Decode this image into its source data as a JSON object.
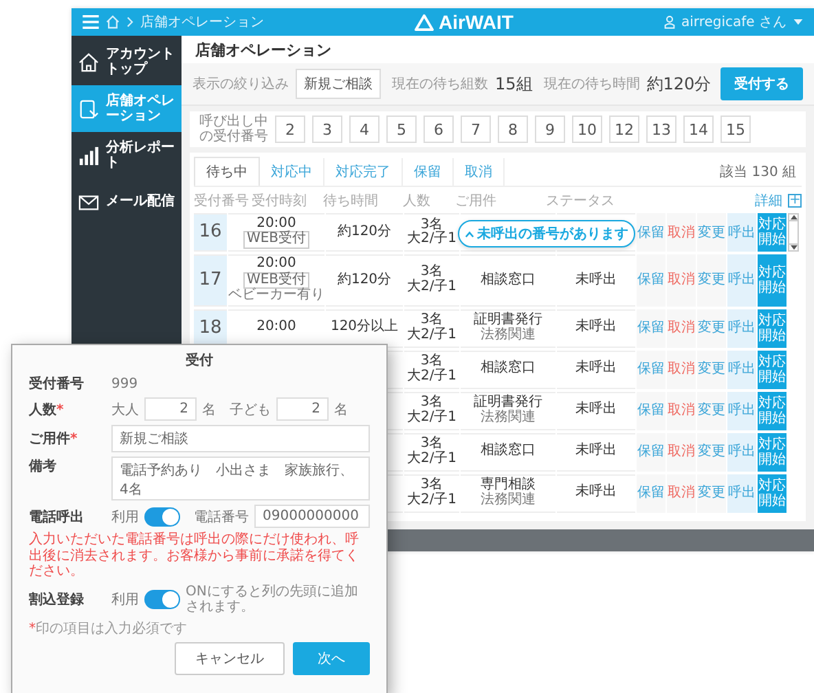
{
  "header": {
    "breadcrumb": "店舗オペレーション",
    "logo": "AirWAIT",
    "user": "airregicafe さん"
  },
  "sidebar": {
    "items": [
      {
        "label": "アカウントトップ",
        "selected": false
      },
      {
        "label": "店舗オペレーション",
        "selected": true
      },
      {
        "label": "分析レポート",
        "selected": false
      },
      {
        "label": "メール配信",
        "selected": false
      }
    ]
  },
  "page_title": "店舗オペレーション",
  "filter": {
    "label": "表示の絞り込み",
    "value": "新規ご相談"
  },
  "stats": [
    {
      "label": "現在の待ち組数",
      "value": "15組"
    },
    {
      "label": "現在の待ち時間",
      "value": "約120分"
    }
  ],
  "primary_button": "受付する",
  "calling": {
    "label": "呼び出し中の受付番号",
    "numbers": [
      "2",
      "3",
      "4",
      "5",
      "6",
      "7",
      "8",
      "9",
      "10",
      "12",
      "13",
      "14",
      "15"
    ]
  },
  "tabs": [
    {
      "label": "待ち中",
      "selected": true
    },
    {
      "label": "対応中",
      "selected": false
    },
    {
      "label": "対応完了",
      "selected": false
    },
    {
      "label": "保留",
      "selected": false
    },
    {
      "label": "取消",
      "selected": false
    }
  ],
  "count": "該当 130 組",
  "columns": [
    "受付番号",
    "受付時刻",
    "待ち時間",
    "人数",
    "ご用件",
    "ステータス"
  ],
  "detail_link": "詳細",
  "add_button": "+",
  "notice": "未呼出の番号があります",
  "rows": [
    {
      "number": "16",
      "time": "20:00",
      "tag": "WEB受付",
      "wait": "約120分",
      "people": "3名",
      "breakdown": "大2/子1",
      "actions": [
        {
          "label": "保留",
          "kind": "hold"
        },
        {
          "label": "取消",
          "kind": "cancel"
        },
        {
          "label": "変更",
          "kind": "change"
        },
        {
          "label": "呼出",
          "kind": "call"
        },
        {
          "label": "対応開始",
          "kind": "start"
        }
      ]
    },
    {
      "number": "17",
      "time": "20:00",
      "tag": "WEB受付",
      "note": "ベビーカー有り",
      "wait": "約120分",
      "people": "3名",
      "breakdown": "大2/子1",
      "purpose": "相談窓口",
      "status": "未呼出",
      "actions": [
        {
          "label": "保留",
          "kind": "hold"
        },
        {
          "label": "取消",
          "kind": "cancel"
        },
        {
          "label": "変更",
          "kind": "change"
        },
        {
          "label": "呼出",
          "kind": "call"
        },
        {
          "label": "対応開始",
          "kind": "start"
        }
      ]
    },
    {
      "number": "18",
      "time": "20:00",
      "wait": "120分以上",
      "people": "3名",
      "breakdown": "大2/子1",
      "purpose": "証明書発行",
      "purpose_sub": "法務関連",
      "status": "未呼出",
      "actions": [
        {
          "label": "保留",
          "kind": "hold"
        },
        {
          "label": "取消",
          "kind": "cancel"
        },
        {
          "label": "変更",
          "kind": "change"
        },
        {
          "label": "呼出",
          "kind": "call"
        },
        {
          "label": "対応開始",
          "kind": "start"
        }
      ]
    },
    {
      "people": "3名",
      "breakdown": "大2/子1",
      "purpose": "相談窓口",
      "status": "未呼出",
      "actions": [
        {
          "label": "保留",
          "kind": "hold"
        },
        {
          "label": "取消",
          "kind": "cancel"
        },
        {
          "label": "変更",
          "kind": "change"
        },
        {
          "label": "呼出",
          "kind": "call"
        },
        {
          "label": "対応開始",
          "kind": "start"
        }
      ]
    },
    {
      "people": "3名",
      "breakdown": "大2/子1",
      "purpose": "証明書発行",
      "purpose_sub": "法務関連",
      "status": "未呼出",
      "actions": [
        {
          "label": "保留",
          "kind": "hold"
        },
        {
          "label": "取消",
          "kind": "cancel"
        },
        {
          "label": "変更",
          "kind": "change"
        },
        {
          "label": "呼出",
          "kind": "call"
        },
        {
          "label": "対応開始",
          "kind": "start"
        }
      ]
    },
    {
      "people": "3名",
      "breakdown": "大2/子1",
      "purpose": "相談窓口",
      "status": "未呼出",
      "actions": [
        {
          "label": "保留",
          "kind": "hold"
        },
        {
          "label": "取消",
          "kind": "cancel"
        },
        {
          "label": "変更",
          "kind": "change"
        },
        {
          "label": "呼出",
          "kind": "call"
        },
        {
          "label": "対応開始",
          "kind": "start"
        }
      ]
    },
    {
      "people": "3名",
      "breakdown": "大2/子1",
      "purpose": "専門相談",
      "purpose_sub": "法務関連",
      "status": "未呼出",
      "actions": [
        {
          "label": "保留",
          "kind": "hold"
        },
        {
          "label": "取消",
          "kind": "cancel"
        },
        {
          "label": "変更",
          "kind": "change"
        },
        {
          "label": "呼出",
          "kind": "call"
        },
        {
          "label": "対応開始",
          "kind": "start"
        }
      ]
    }
  ],
  "dialog": {
    "title": "受付",
    "required_mark": "*",
    "receipt": {
      "label": "受付番号",
      "value": "999"
    },
    "people": {
      "label": "人数",
      "required": true,
      "adult_label": "大人",
      "adults": "2",
      "adult_unit": "名",
      "child_label": "子ども",
      "children": "2",
      "child_unit": "名"
    },
    "purpose": {
      "label": "ご用件",
      "required": true,
      "value": "新規ご相談"
    },
    "remarks": {
      "label": "備考",
      "value": "電話予約あり　小出さま　家族旅行、4名"
    },
    "phone_call": {
      "label": "電話呼出",
      "switch_label": "利用",
      "on": true,
      "number_label": "電話番号",
      "number": "09000000000",
      "warning": "入力いただいた電話番号は呼出の際にだけ使われ、呼出後に消去されます。お客様から事前に承諾を得てください。"
    },
    "priority": {
      "label": "割込登録",
      "switch_label": "利用",
      "on": true,
      "hint": "ONにすると列の先頭に追加されます。"
    },
    "required_note": {
      "mark": "*",
      "text": "印の項目は入力必須です"
    },
    "buttons": [
      {
        "label": "キャンセル",
        "kind": "secondary"
      },
      {
        "label": "次へ",
        "kind": "primary"
      }
    ]
  }
}
